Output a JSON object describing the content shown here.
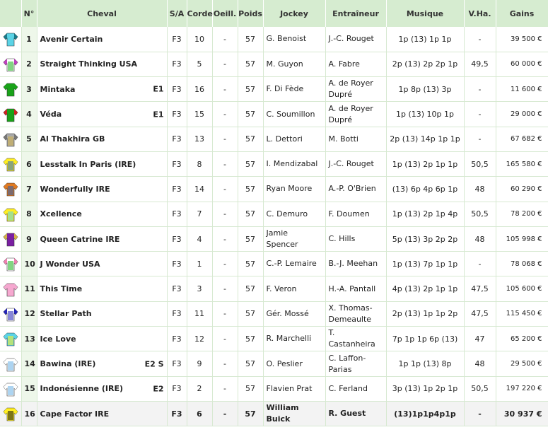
{
  "headers": {
    "num": "N°",
    "cheval": "Cheval",
    "sa": "S/A",
    "corde": "Corde",
    "oeil": "Oeill.",
    "poids": "Poids",
    "jockey": "Jockey",
    "trainer": "Entraîneur",
    "music": "Musique",
    "vha": "V.Ha.",
    "gains": "Gains"
  },
  "runners": [
    {
      "num": "1",
      "horse": "Avenir Certain",
      "eq": "",
      "sa": "F3",
      "corde": "10",
      "oeil": "-",
      "poids": "57",
      "jockey": "G. Benoist",
      "trainer": "J.-C. Rouget",
      "music": "1p (13) 1p 1p",
      "vha": "-",
      "gains": "39 500 €",
      "silk_colors": [
        "#5bd3e6",
        "#5bd3e6",
        "#1a7a8a"
      ]
    },
    {
      "num": "2",
      "horse": "Straight Thinking USA",
      "eq": "",
      "sa": "F3",
      "corde": "5",
      "oeil": "-",
      "poids": "57",
      "jockey": "M. Guyon",
      "trainer": "A. Fabre",
      "music": "2p (13) 2p 2p 1p",
      "vha": "49,5",
      "gains": "60 000 €",
      "silk_colors": [
        "#ffffff",
        "#19b319",
        "#c040c0"
      ]
    },
    {
      "num": "3",
      "horse": "Mintaka",
      "eq": "E1",
      "sa": "F3",
      "corde": "16",
      "oeil": "-",
      "poids": "57",
      "jockey": "F. Di Fède",
      "trainer": "A. de Royer Dupré",
      "music": "1p 8p (13) 3p",
      "vha": "-",
      "gains": "11 600 €",
      "silk_colors": [
        "#19a319",
        "#19a319",
        "#19a319"
      ]
    },
    {
      "num": "4",
      "horse": "Véda",
      "eq": "E1",
      "sa": "F3",
      "corde": "15",
      "oeil": "-",
      "poids": "57",
      "jockey": "C. Soumillon",
      "trainer": "A. de Royer Dupré",
      "music": "1p (13) 10p 1p",
      "vha": "-",
      "gains": "29 000 €",
      "silk_colors": [
        "#19a319",
        "#19a319",
        "#cc2222"
      ]
    },
    {
      "num": "5",
      "horse": "Al Thakhira GB",
      "eq": "",
      "sa": "F3",
      "corde": "13",
      "oeil": "-",
      "poids": "57",
      "jockey": "L. Dettori",
      "trainer": "M. Botti",
      "music": "2p (13) 14p 1p 1p",
      "vha": "-",
      "gains": "67 682 €",
      "silk_colors": [
        "#a9a9a9",
        "#d4b24a",
        "#777777"
      ]
    },
    {
      "num": "6",
      "horse": "Lesstalk In Paris (IRE)",
      "eq": "",
      "sa": "F3",
      "corde": "8",
      "oeil": "-",
      "poids": "57",
      "jockey": "I. Mendizabal",
      "trainer": "J.-C. Rouget",
      "music": "1p (13) 2p 1p 1p",
      "vha": "50,5",
      "gains": "165 580 €",
      "silk_colors": [
        "#ffee22",
        "#2a66c8",
        "#ffee22"
      ]
    },
    {
      "num": "7",
      "horse": "Wonderfully IRE",
      "eq": "",
      "sa": "F3",
      "corde": "14",
      "oeil": "-",
      "poids": "57",
      "jockey": "Ryan Moore",
      "trainer": "A.-P. O'Brien",
      "music": "(13) 6p 4p 6p 1p",
      "vha": "48",
      "gains": "60 290 €",
      "silk_colors": [
        "#e07a22",
        "#2a5fb0",
        "#e07a22"
      ]
    },
    {
      "num": "8",
      "horse": "Xcellence",
      "eq": "",
      "sa": "F3",
      "corde": "7",
      "oeil": "-",
      "poids": "57",
      "jockey": "C. Demuro",
      "trainer": "F. Doumen",
      "music": "1p (13) 2p 1p 4p",
      "vha": "50,5",
      "gains": "78 200 €",
      "silk_colors": [
        "#ffee22",
        "#5bd3e6",
        "#ffee22"
      ]
    },
    {
      "num": "9",
      "horse": "Queen Catrine IRE",
      "eq": "",
      "sa": "F3",
      "corde": "4",
      "oeil": "-",
      "poids": "57",
      "jockey": "Jamie Spencer",
      "trainer": "C. Hills",
      "music": "5p (13) 3p 2p 2p",
      "vha": "48",
      "gains": "105 998 €",
      "silk_colors": [
        "#7a1fa2",
        "#7a1fa2",
        "#d4b24a"
      ]
    },
    {
      "num": "10",
      "horse": "J Wonder USA",
      "eq": "",
      "sa": "F3",
      "corde": "1",
      "oeil": "-",
      "poids": "57",
      "jockey": "C.-P. Lemaire",
      "trainer": "B.-J. Meehan",
      "music": "1p (13) 7p 1p 1p",
      "vha": "-",
      "gains": "78 068 €",
      "silk_colors": [
        "#ffffff",
        "#19b319",
        "#f080b0"
      ]
    },
    {
      "num": "11",
      "horse": "This Time",
      "eq": "",
      "sa": "F3",
      "corde": "3",
      "oeil": "-",
      "poids": "57",
      "jockey": "F. Veron",
      "trainer": "H.-A. Pantall",
      "music": "4p (13) 2p 1p 1p",
      "vha": "47,5",
      "gains": "105 600 €",
      "silk_colors": [
        "#f5a8d0",
        "#f5a8d0",
        "#f5a8d0"
      ]
    },
    {
      "num": "12",
      "horse": "Stellar Path",
      "eq": "",
      "sa": "F3",
      "corde": "11",
      "oeil": "-",
      "poids": "57",
      "jockey": "Gér. Mossé",
      "trainer": "X. Thomas-Demeaulte",
      "music": "2p (13) 1p 1p 2p",
      "vha": "47,5",
      "gains": "115 450 €",
      "silk_colors": [
        "#ffffff",
        "#2424b8",
        "#2424b8"
      ]
    },
    {
      "num": "13",
      "horse": "Ice Love",
      "eq": "",
      "sa": "F3",
      "corde": "12",
      "oeil": "-",
      "poids": "57",
      "jockey": "R. Marchelli",
      "trainer": "T. Castanheira",
      "music": "7p 1p 1p 6p (13)",
      "vha": "47",
      "gains": "65 200 €",
      "silk_colors": [
        "#5bd3e6",
        "#ffee22",
        "#5bd3e6"
      ]
    },
    {
      "num": "14",
      "horse": "Bawina (IRE)",
      "eq": "E2 S",
      "sa": "F3",
      "corde": "9",
      "oeil": "-",
      "poids": "57",
      "jockey": "O. Peslier",
      "trainer": "C. Laffon-Parias",
      "music": "1p 1p (13) 8p",
      "vha": "48",
      "gains": "29 500 €",
      "silk_colors": [
        "#ffffff",
        "#6ab0e6",
        "#ffffff"
      ]
    },
    {
      "num": "15",
      "horse": "Indonésienne (IRE)",
      "eq": "E2",
      "sa": "F3",
      "corde": "2",
      "oeil": "-",
      "poids": "57",
      "jockey": "Flavien Prat",
      "trainer": "C. Ferland",
      "music": "3p (13) 1p 2p 1p",
      "vha": "50,5",
      "gains": "197 220 €",
      "silk_colors": [
        "#ffffff",
        "#6ab0e6",
        "#ffffff"
      ]
    },
    {
      "num": "16",
      "horse": "Cape Factor IRE",
      "eq": "",
      "sa": "F3",
      "corde": "6",
      "oeil": "-",
      "poids": "57",
      "jockey": "William Buick",
      "trainer": "R. Guest",
      "music": "(13)1p1p4p1p",
      "vha": "-",
      "gains": "30 937 €",
      "silk_colors": [
        "#ffee22",
        "#111111",
        "#ffee22"
      ]
    }
  ]
}
